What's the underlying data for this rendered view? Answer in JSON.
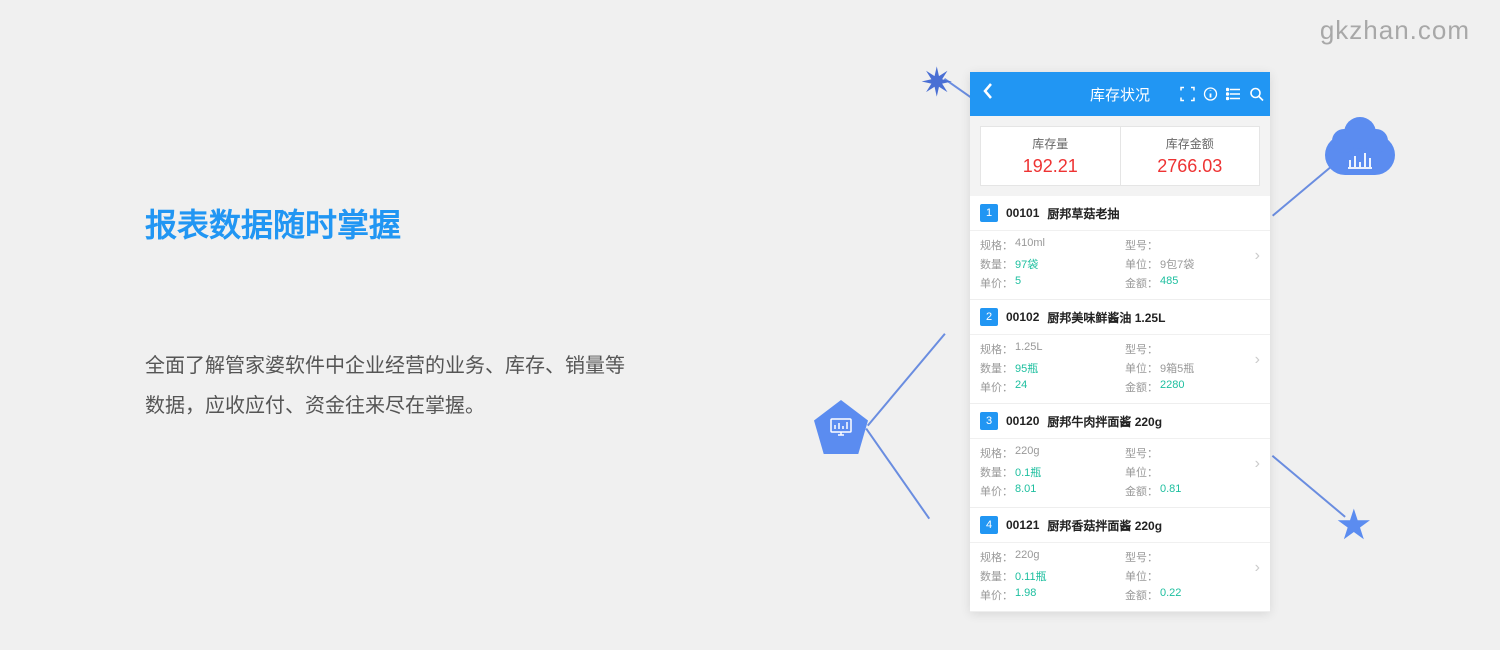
{
  "watermark": "gkzhan.com",
  "marketing": {
    "title": "报表数据随时掌握",
    "description": "全面了解管家婆软件中企业经营的业务、库存、销量等数据，应收应付、资金往来尽在掌握。"
  },
  "phone": {
    "title": "库存状况",
    "summary": {
      "qty_label": "库存量",
      "qty_value": "192.21",
      "amount_label": "库存金额",
      "amount_value": "2766.03"
    },
    "labels": {
      "spec": "规格：",
      "model": "型号：",
      "qty": "数量：",
      "unit": "单位：",
      "price": "单价：",
      "amount": "金额："
    },
    "items": [
      {
        "idx": "1",
        "code": "00101",
        "name": "厨邦草菇老抽",
        "spec": "410ml",
        "model": "",
        "qty": "97袋",
        "unit": "9包7袋",
        "price": "5",
        "amount": "485"
      },
      {
        "idx": "2",
        "code": "00102",
        "name": "厨邦美味鲜酱油 1.25L",
        "spec": "1.25L",
        "model": "",
        "qty": "95瓶",
        "unit": "9箱5瓶",
        "price": "24",
        "amount": "2280"
      },
      {
        "idx": "3",
        "code": "00120",
        "name": "厨邦牛肉拌面酱 220g",
        "spec": "220g",
        "model": "",
        "qty": "0.1瓶",
        "unit": "",
        "price": "8.01",
        "amount": "0.81"
      },
      {
        "idx": "4",
        "code": "00121",
        "name": "厨邦香菇拌面酱 220g",
        "spec": "220g",
        "model": "",
        "qty": "0.11瓶",
        "unit": "",
        "price": "1.98",
        "amount": "0.22"
      }
    ]
  }
}
